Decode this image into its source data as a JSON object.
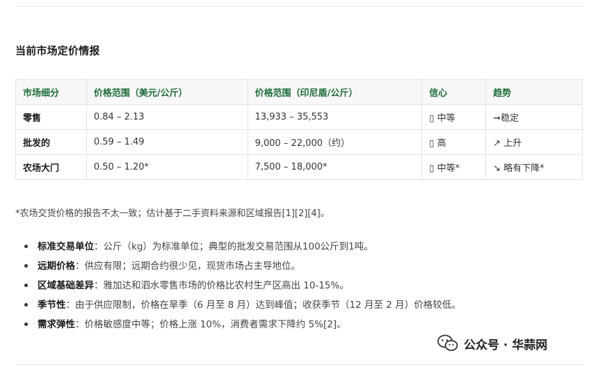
{
  "section_title": "当前市场定价情报",
  "table": {
    "headers": [
      "市场细分",
      "价格范围（美元/公斤）",
      "价格范围（印尼盾/公斤）",
      "信心",
      "趋势"
    ],
    "rows": [
      {
        "segment": "零售",
        "usd": "0.84 – 2.13",
        "idr": "13,933 – 35,553",
        "confidence": "中等",
        "trend": "稳定"
      },
      {
        "segment": "批发的",
        "usd": "0.59 – 1.49",
        "idr": "9,000 – 22,000（约）",
        "confidence": "高",
        "trend": "上升"
      },
      {
        "segment": "农场大门",
        "usd": "0.50 – 1.20*",
        "idr": "7,500 – 18,000*",
        "confidence": "中等*",
        "trend": "略有下降*"
      }
    ]
  },
  "footnote": "*农场交货价格的报告不太一致；估计基于二手资料来源和区域报告[1][2][4]。",
  "bullets": [
    {
      "term": "标准交易单位",
      "text": "：公斤（kg）为标准单位；典型的批发交易范围从100公斤到1吨。"
    },
    {
      "term": "远期价格",
      "text": "：供应有限；远期合约很少见，现货市场占主导地位。"
    },
    {
      "term": "区域基础差异",
      "text": "：雅加达和泗水零售市场的价格比农村生产区高出 10-15%。"
    },
    {
      "term": "季节性",
      "text": "：由于供应限制，价格在旱季（6 月至 8 月）达到峰值；收获季节（12 月至 2 月）价格较低。"
    },
    {
      "term": "需求弹性",
      "text": "：价格敏感度中等；价格上涨 10%，消费者需求下降约 5%[2]。"
    }
  ],
  "icons": {
    "confidence": "missing-glyph-box",
    "trend_stable": "right-arrow",
    "trend_up": "up-right-arrow",
    "trend_down": "down-right-arrow"
  },
  "glyphs": {
    "confidence": "▯",
    "trend": [
      "➞",
      "↗",
      "↘"
    ]
  },
  "watermark": "公众号 · 华蒜网"
}
